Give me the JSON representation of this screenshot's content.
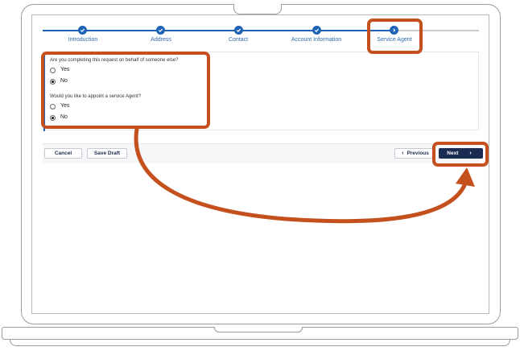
{
  "stepper": {
    "steps": [
      {
        "label": "Introduction",
        "state": "complete"
      },
      {
        "label": "Address",
        "state": "complete"
      },
      {
        "label": "Contact",
        "state": "complete"
      },
      {
        "label": "Account Information",
        "state": "complete"
      },
      {
        "label": "Service Agent",
        "state": "current"
      }
    ]
  },
  "form": {
    "q1": {
      "text": "Are you completing this request on behalf of someone else?",
      "options": [
        "Yes",
        "No"
      ],
      "selected": "No"
    },
    "q2": {
      "text": "Would you like to appoint a service Agent?",
      "options": [
        "Yes",
        "No"
      ],
      "selected": "No"
    }
  },
  "actions": {
    "cancel_label": "Cancel",
    "save_draft_label": "Save Draft",
    "previous_label": "Previous",
    "next_label": "Next"
  },
  "colors": {
    "accent": "#1f63b6",
    "primary_button": "#1a2c52",
    "annotation": "#c4501e"
  },
  "icons": {
    "step_complete": "checkmark-icon",
    "step_current": "chevron-right-icon",
    "annotation_arrow": "curved-arrow-icon"
  }
}
